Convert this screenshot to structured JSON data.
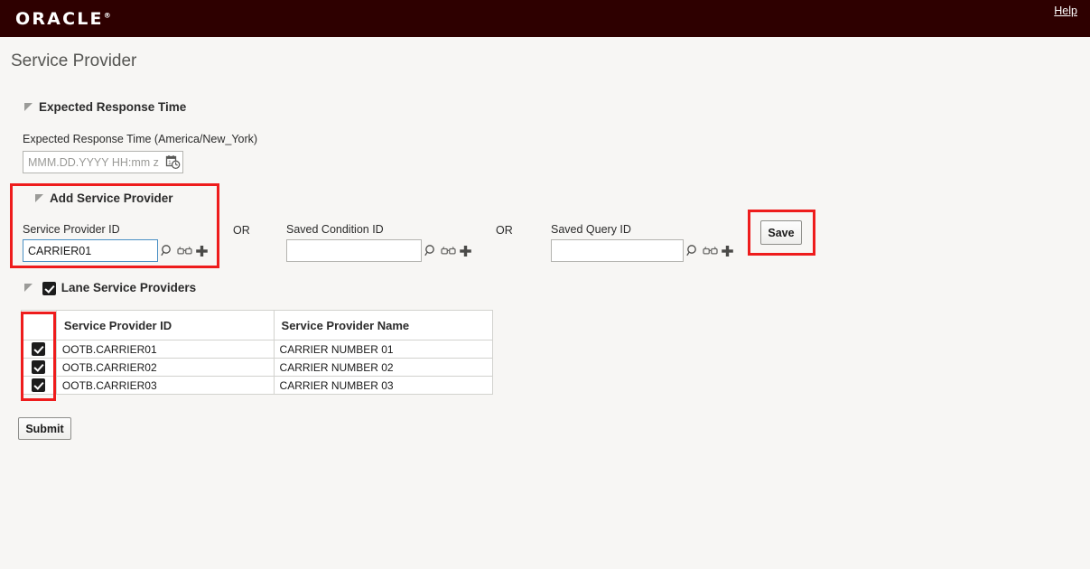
{
  "brand": {
    "logo_text": "ORACLE",
    "registered_mark": "®",
    "help_label": "Help"
  },
  "page": {
    "title": "Service Provider"
  },
  "expected_response_time": {
    "section_label": "Expected Response Time",
    "field_label": "Expected Response Time (America/New_York)",
    "field_value": "",
    "field_placeholder": "MMM.DD.YYYY HH:mm z",
    "picker_icon": "calendar-clock-icon"
  },
  "add_service_provider": {
    "section_label": "Add Service Provider",
    "service_provider_id": {
      "label": "Service Provider ID",
      "value": "CARRIER01",
      "placeholder": "",
      "focused": true
    },
    "or_1": "OR",
    "saved_condition_id": {
      "label": "Saved Condition ID",
      "value": "",
      "placeholder": ""
    },
    "or_2": "OR",
    "saved_query_id": {
      "label": "Saved Query ID",
      "value": "",
      "placeholder": ""
    },
    "save_button": "Save",
    "icons": [
      "search-icon",
      "binoculars-icon",
      "plus-icon"
    ]
  },
  "lane_service_providers": {
    "section_label": "Lane Service Providers",
    "section_checked": true,
    "columns": [
      "",
      "Service Provider ID",
      "Service Provider Name"
    ],
    "rows": [
      {
        "checked": true,
        "id": "OOTB.CARRIER01",
        "name": "CARRIER NUMBER 01"
      },
      {
        "checked": true,
        "id": "OOTB.CARRIER02",
        "name": "CARRIER NUMBER 02"
      },
      {
        "checked": true,
        "id": "OOTB.CARRIER03",
        "name": "CARRIER NUMBER 03"
      }
    ]
  },
  "footer": {
    "submit_button": "Submit"
  },
  "colors": {
    "brand_bar": "#2e0000",
    "page_background": "#f7f6f4",
    "annotation_red": "#ee1c1c",
    "input_focus_border": "#4a90c4"
  }
}
